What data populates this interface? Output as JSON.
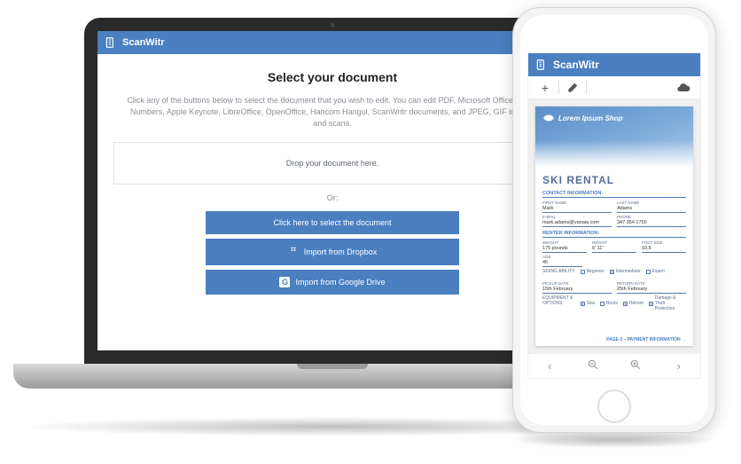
{
  "appName": "ScanWitr",
  "laptop": {
    "title": "Select your document",
    "description": "Click any of the buttons below to select the document that you wish to edit. You can edit PDF, Microsoft Office, Apple Numbers, Apple Keynote, LibreOffice, OpenOffice, Hancom Hangul, ScanWritr documents, and JPEG, GIF images and scans.",
    "dropzone": "Drop your document here.",
    "or": "Or:",
    "buttons": {
      "select": "Click here to select the document",
      "dropbox": "Import from Dropbox",
      "gdrive": "Import from Google Drive"
    }
  },
  "document": {
    "shopName": "Lorem Ipsum Shop",
    "title": "SKI RENTAL",
    "sections": {
      "contact": "CONTACT INFORMATION:",
      "renter": "RENTER INFORMATION:"
    },
    "fields": {
      "firstNameLabel": "FIRST NAME",
      "firstName": "Mark",
      "lastNameLabel": "LAST NAME",
      "lastName": "Adams",
      "emailLabel": "E-MAIL",
      "email": "mark.adams@vanaia.com",
      "phoneLabel": "PHONE",
      "phone": "347 354 1750",
      "weightLabel": "WEIGHT",
      "weight": "175 pounds",
      "heightLabel": "HEIGHT",
      "height": "6' 11\"",
      "footLabel": "FOOT SIZE",
      "foot": "10,5",
      "ageLabel": "AGE",
      "age": "45",
      "skiAbilityLabel": "SKIING ABILITY",
      "pickupLabel": "PICKUP DATE",
      "pickup": "15th February",
      "returnLabel": "RETURN DATE",
      "returnDate": "25th February",
      "equipLabel": "EQUIPMENT & OPTIONS"
    },
    "options": {
      "beginner": "Beginner",
      "intermediate": "Intermediate",
      "expert": "Expert",
      "skis": "Skis",
      "boots": "Boots",
      "helmet": "Helmet",
      "damage": "Damage & Theft Protection"
    },
    "footer": "PAGE 2 – PAYMENT INFORMATION  →"
  }
}
